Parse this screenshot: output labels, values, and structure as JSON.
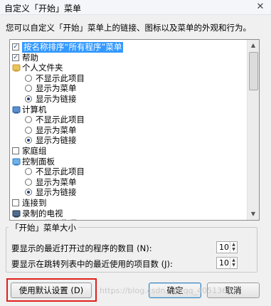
{
  "window": {
    "title": "自定义「开始」菜单",
    "close_glyph": "✕"
  },
  "description": "您可以自定义「开始」菜单上的链接、图标以及菜单的外观和行为。",
  "list": {
    "items": [
      {
        "type": "checkbox",
        "checked": true,
        "label": "按名称排序“所有程序”菜单",
        "selected": true
      },
      {
        "type": "checkbox",
        "checked": true,
        "label": "帮助"
      },
      {
        "type": "folder",
        "icon": "folder-user-icon",
        "label": "个人文件夹"
      },
      {
        "type": "radio",
        "checked": false,
        "label": "不显示此项目"
      },
      {
        "type": "radio",
        "checked": false,
        "label": "显示为菜单"
      },
      {
        "type": "radio",
        "checked": true,
        "label": "显示为链接"
      },
      {
        "type": "folder",
        "icon": "computer-icon",
        "label": "计算机"
      },
      {
        "type": "radio",
        "checked": false,
        "label": "不显示此项目"
      },
      {
        "type": "radio",
        "checked": false,
        "label": "显示为菜单"
      },
      {
        "type": "radio",
        "checked": true,
        "label": "显示为链接"
      },
      {
        "type": "checkbox",
        "checked": false,
        "label": "家庭组"
      },
      {
        "type": "folder",
        "icon": "control-panel-icon",
        "label": "控制面板"
      },
      {
        "type": "radio",
        "checked": false,
        "label": "不显示此项目"
      },
      {
        "type": "radio",
        "checked": false,
        "label": "显示为菜单"
      },
      {
        "type": "radio",
        "checked": true,
        "label": "显示为链接"
      },
      {
        "type": "checkbox",
        "checked": false,
        "label": "连接到"
      },
      {
        "type": "folder",
        "icon": "recorded-tv-icon",
        "label": "录制的电视"
      },
      {
        "type": "radio",
        "checked": true,
        "label": "不显示此项目"
      }
    ]
  },
  "size_group": {
    "title": "「开始」菜单大小",
    "recent_programs_label": "要显示的最近打开过的程序的数目 (N):",
    "recent_programs_value": "10",
    "jump_list_label": "要显示在跳转列表中的最近使用的项目数 (J):",
    "jump_list_value": "10"
  },
  "buttons": {
    "defaults": "使用默认设置 (D)",
    "ok": "确定",
    "cancel": "取消"
  },
  "watermark": "https://blog.csdn.net/qq_40513632"
}
